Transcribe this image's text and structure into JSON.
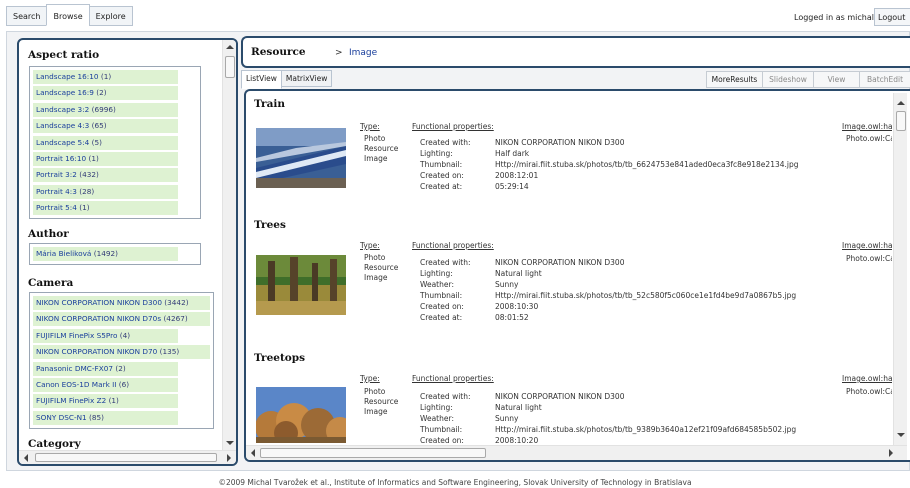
{
  "nav": {
    "tabs": [
      {
        "label": "Search"
      },
      {
        "label": "Browse"
      },
      {
        "label": "Explore"
      }
    ],
    "logged_in": "Logged in as michal",
    "logout": "Logout"
  },
  "facets": {
    "aspect_ratio": {
      "title": "Aspect ratio",
      "items": [
        {
          "label": "Landscape 16:10",
          "count": "(1)"
        },
        {
          "label": "Landscape 16:9",
          "count": "(2)"
        },
        {
          "label": "Landscape 3:2",
          "count": "(6996)"
        },
        {
          "label": "Landscape 4:3",
          "count": "(65)"
        },
        {
          "label": "Landscape 5:4",
          "count": "(5)"
        },
        {
          "label": "Portrait 16:10",
          "count": "(1)"
        },
        {
          "label": "Portrait 3:2",
          "count": "(432)"
        },
        {
          "label": "Portrait 4:3",
          "count": "(28)"
        },
        {
          "label": "Portrait 5:4",
          "count": "(1)"
        }
      ]
    },
    "author": {
      "title": "Author",
      "items": [
        {
          "label": "Mária Bieliková",
          "count": "(1492)"
        }
      ]
    },
    "camera": {
      "title": "Camera",
      "items": [
        {
          "label": "NIKON CORPORATION NIKON D300",
          "count": "(3442)"
        },
        {
          "label": "NIKON CORPORATION NIKON D70s",
          "count": "(4267)"
        },
        {
          "label": "FUJIFILM FinePix S5Pro",
          "count": "(4)"
        },
        {
          "label": "NIKON CORPORATION NIKON D70",
          "count": "(135)"
        },
        {
          "label": "Panasonic DMC-FX07",
          "count": "(2)"
        },
        {
          "label": "Canon EOS-1D Mark II",
          "count": "(6)"
        },
        {
          "label": "FUJIFILM FinePix Z2",
          "count": "(1)"
        },
        {
          "label": "SONY DSC-N1",
          "count": "(85)"
        }
      ]
    },
    "category": {
      "title": "Category"
    }
  },
  "resource": {
    "title": "Resource",
    "separator": ">",
    "crumb": "Image"
  },
  "views": {
    "tabs": [
      {
        "label": "ListView"
      },
      {
        "label": "MatrixView"
      }
    ],
    "buttons": [
      {
        "label": "MoreResults"
      },
      {
        "label": "Slideshow"
      },
      {
        "label": "View"
      },
      {
        "label": "BatchEdit"
      }
    ]
  },
  "list": {
    "type_label": "Type:",
    "fp_label": "Functional properties:",
    "owl_label": "Image.owl:hasThumbnail",
    "owl_sub": "Photo.owl:Camera",
    "items": [
      {
        "title": "Train",
        "types": [
          "Photo",
          "Resource",
          "Image"
        ],
        "props": [
          {
            "k": "Created with:",
            "v": "NIKON CORPORATION NIKON D300"
          },
          {
            "k": "Lighting:",
            "v": "Half dark"
          },
          {
            "k": "Thumbnail:",
            "v": "Http://mirai.fiit.stuba.sk/photos/tb/tb_6624753e841aded0eca3fc8e918e2134.jpg"
          },
          {
            "k": "Created on:",
            "v": "2008:12:01"
          },
          {
            "k": "Created at:",
            "v": "05:29:14"
          }
        ]
      },
      {
        "title": "Trees",
        "types": [
          "Photo",
          "Resource",
          "Image"
        ],
        "props": [
          {
            "k": "Created with:",
            "v": "NIKON CORPORATION NIKON D300"
          },
          {
            "k": "Lighting:",
            "v": "Natural light"
          },
          {
            "k": "Weather:",
            "v": "Sunny"
          },
          {
            "k": "Thumbnail:",
            "v": "Http://mirai.fiit.stuba.sk/photos/tb/tb_52c580f5c060ce1e1fd4be9d7a0867b5.jpg"
          },
          {
            "k": "Created on:",
            "v": "2008:10:30"
          },
          {
            "k": "Created at:",
            "v": "08:01:52"
          }
        ]
      },
      {
        "title": "Treetops",
        "types": [
          "Photo",
          "Resource",
          "Image"
        ],
        "props": [
          {
            "k": "Created with:",
            "v": "NIKON CORPORATION NIKON D300"
          },
          {
            "k": "Lighting:",
            "v": "Natural light"
          },
          {
            "k": "Weather:",
            "v": "Sunny"
          },
          {
            "k": "Thumbnail:",
            "v": "Http://mirai.fiit.stuba.sk/photos/tb/tb_9389b3640a12ef21f09afd684585b502.jpg"
          },
          {
            "k": "Created on:",
            "v": "2008:10:20"
          }
        ]
      }
    ]
  },
  "footer": "©2009 Michal Tvarožek et al., Institute of Informatics and Software Engineering, Slovak University of Technology in Bratislava",
  "colors": {
    "panel_border": "#2b4b6b",
    "facet_fill": "#def2d2",
    "link": "#1a3f9c"
  }
}
